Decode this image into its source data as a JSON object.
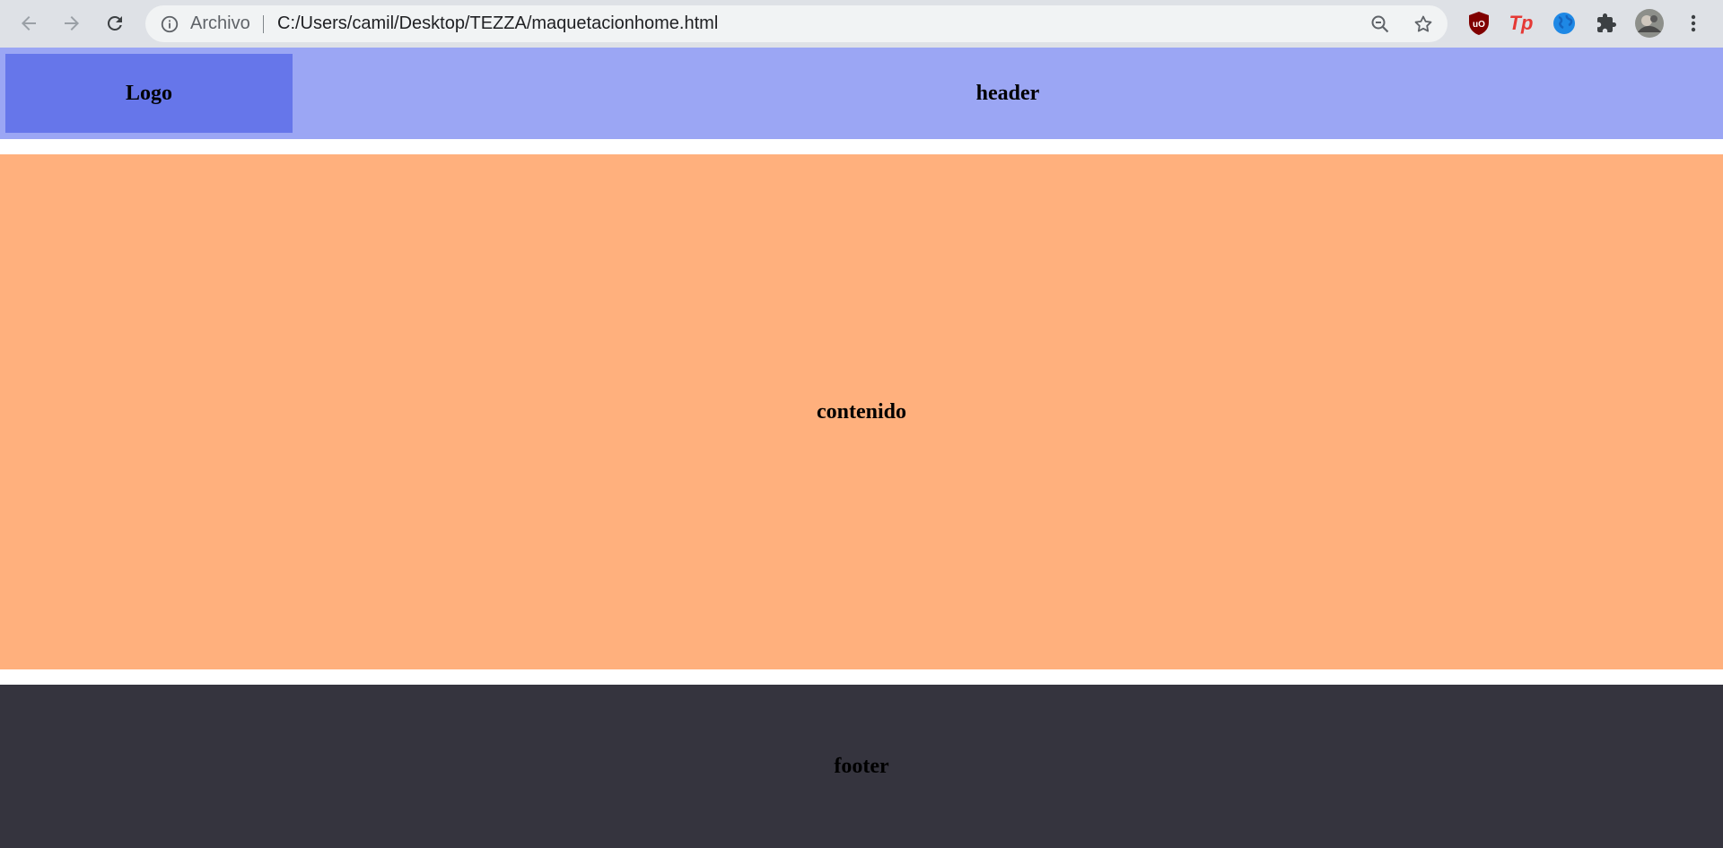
{
  "browser": {
    "origin_chip": "Archivo",
    "url": "C:/Users/camil/Desktop/TEZZA/maquetacionhome.html",
    "icons": [
      "back-arrow-icon",
      "forward-arrow-icon",
      "reload-icon",
      "info-icon",
      "zoom-out-icon",
      "bookmark-star-icon",
      "ublock-icon",
      "tp-extension-icon",
      "globe-extension-icon",
      "extensions-puzzle-icon",
      "profile-avatar",
      "menu-kebab-icon"
    ],
    "extensions": {
      "tp_label": "Tp",
      "ublock_label": "uO"
    }
  },
  "page": {
    "logo": "Logo",
    "header": "header",
    "content": "contenido",
    "footer": "footer"
  },
  "colors": {
    "header_bg": "#9ba6f4",
    "logo_bg": "#6676ea",
    "content_bg": "#ffb07d",
    "footer_bg": "#35343e"
  }
}
